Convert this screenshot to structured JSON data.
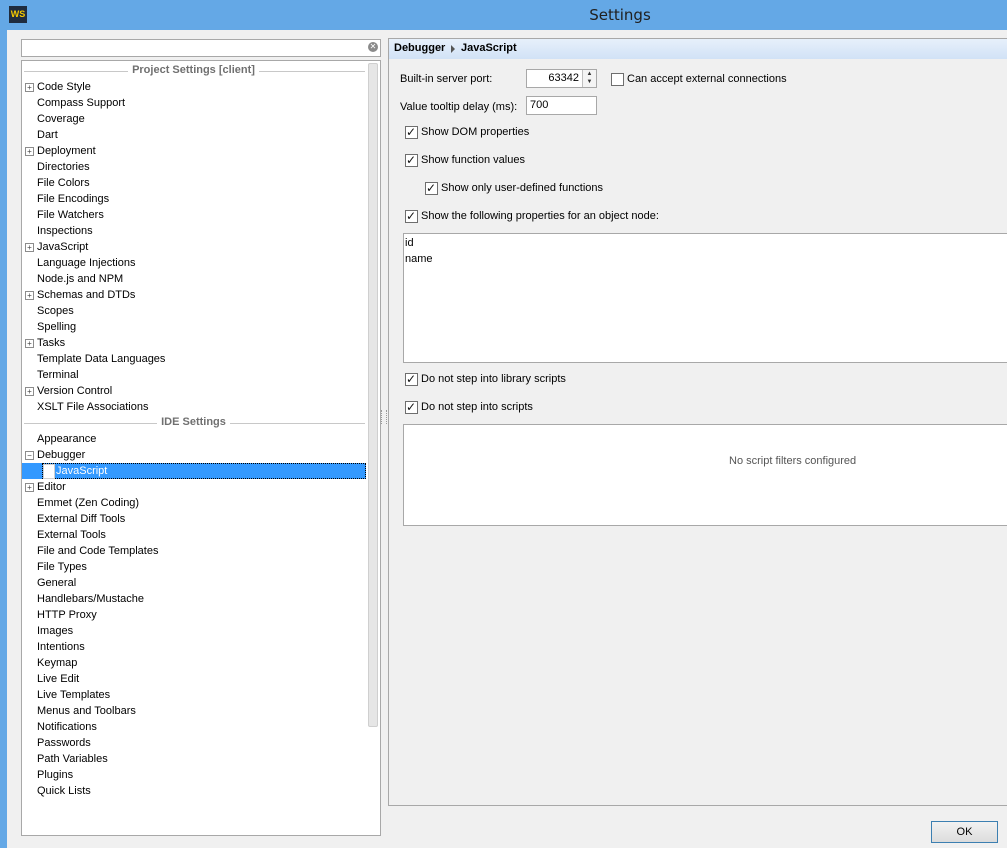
{
  "window": {
    "title": "Settings",
    "app_icon": "WS"
  },
  "search": {
    "placeholder": "",
    "value": ""
  },
  "tree": {
    "project_header": "Project Settings [client]",
    "project_items": [
      {
        "label": "Code Style",
        "expandable": true
      },
      {
        "label": "Compass Support",
        "expandable": false
      },
      {
        "label": "Coverage",
        "expandable": false
      },
      {
        "label": "Dart",
        "expandable": false
      },
      {
        "label": "Deployment",
        "expandable": true
      },
      {
        "label": "Directories",
        "expandable": false
      },
      {
        "label": "File Colors",
        "expandable": false
      },
      {
        "label": "File Encodings",
        "expandable": false
      },
      {
        "label": "File Watchers",
        "expandable": false
      },
      {
        "label": "Inspections",
        "expandable": false
      },
      {
        "label": "JavaScript",
        "expandable": true
      },
      {
        "label": "Language Injections",
        "expandable": false
      },
      {
        "label": "Node.js and NPM",
        "expandable": false
      },
      {
        "label": "Schemas and DTDs",
        "expandable": true
      },
      {
        "label": "Scopes",
        "expandable": false
      },
      {
        "label": "Spelling",
        "expandable": false
      },
      {
        "label": "Tasks",
        "expandable": true
      },
      {
        "label": "Template Data Languages",
        "expandable": false
      },
      {
        "label": "Terminal",
        "expandable": false
      },
      {
        "label": "Version Control",
        "expandable": true
      },
      {
        "label": "XSLT File Associations",
        "expandable": false
      }
    ],
    "ide_header": "IDE Settings",
    "ide_items": [
      {
        "label": "Appearance",
        "expandable": false
      },
      {
        "label": "Debugger",
        "expandable": true,
        "expanded": true
      },
      {
        "label": "JavaScript",
        "child": true,
        "selected": true
      },
      {
        "label": "Editor",
        "expandable": true
      },
      {
        "label": "Emmet (Zen Coding)",
        "expandable": false
      },
      {
        "label": "External Diff Tools",
        "expandable": false
      },
      {
        "label": "External Tools",
        "expandable": false
      },
      {
        "label": "File and Code Templates",
        "expandable": false
      },
      {
        "label": "File Types",
        "expandable": false
      },
      {
        "label": "General",
        "expandable": false
      },
      {
        "label": "Handlebars/Mustache",
        "expandable": false
      },
      {
        "label": "HTTP Proxy",
        "expandable": false
      },
      {
        "label": "Images",
        "expandable": false
      },
      {
        "label": "Intentions",
        "expandable": false
      },
      {
        "label": "Keymap",
        "expandable": false
      },
      {
        "label": "Live Edit",
        "expandable": false
      },
      {
        "label": "Live Templates",
        "expandable": false
      },
      {
        "label": "Menus and Toolbars",
        "expandable": false
      },
      {
        "label": "Notifications",
        "expandable": false
      },
      {
        "label": "Passwords",
        "expandable": false
      },
      {
        "label": "Path Variables",
        "expandable": false
      },
      {
        "label": "Plugins",
        "expandable": false
      },
      {
        "label": "Quick Lists",
        "expandable": false
      }
    ]
  },
  "breadcrumb": {
    "parent": "Debugger",
    "current": "JavaScript"
  },
  "debugger": {
    "port_label": "Built-in server port:",
    "port_value": "63342",
    "external_label": "Can accept external connections",
    "external_checked": false,
    "tooltip_label": "Value tooltip delay (ms):",
    "tooltip_value": "700",
    "show_dom": {
      "label": "Show DOM properties",
      "checked": true
    },
    "show_function": {
      "label": "Show function values",
      "checked": true
    },
    "show_user_defined": {
      "label": "Show only user-defined functions",
      "checked": true
    },
    "show_props": {
      "label": "Show the following properties for an object node:",
      "checked": true
    },
    "properties": [
      "id",
      "name"
    ],
    "no_library": {
      "label": "Do not step into library scripts",
      "checked": true
    },
    "no_scripts": {
      "label": "Do not step into scripts",
      "checked": true
    },
    "filters_empty": "No script filters configured"
  },
  "buttons": {
    "ok": "OK"
  }
}
